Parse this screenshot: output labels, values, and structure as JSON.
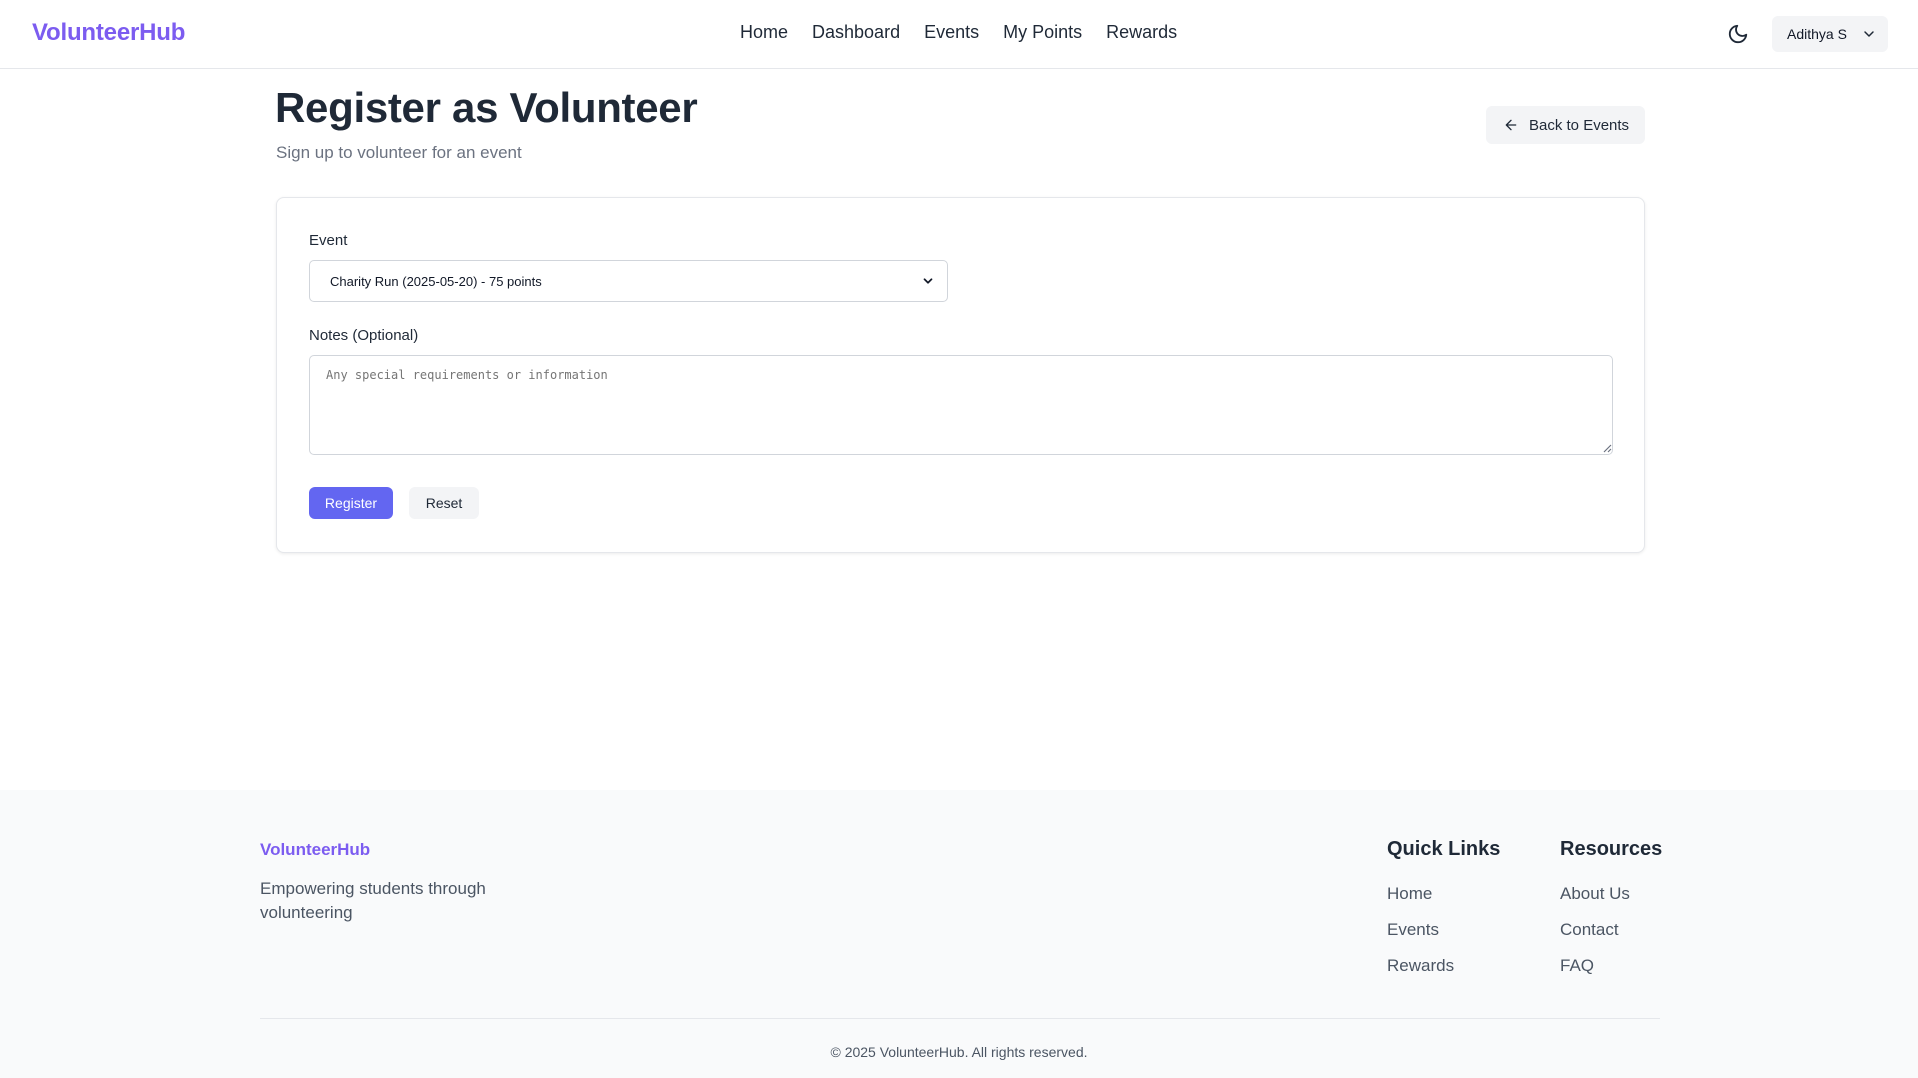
{
  "header": {
    "brand": "VolunteerHub",
    "nav": [
      "Home",
      "Dashboard",
      "Events",
      "My Points",
      "Rewards"
    ],
    "user_name": "Adithya S",
    "theme_icon": "moon-icon"
  },
  "page": {
    "title": "Register as Volunteer",
    "subtitle": "Sign up to volunteer for an event",
    "back_label": "Back to Events"
  },
  "form": {
    "event_label": "Event",
    "event_selected": "Charity Run (2025-05-20) - 75 points",
    "notes_label": "Notes (Optional)",
    "notes_placeholder": "Any special requirements or information",
    "notes_value": "",
    "register_label": "Register",
    "reset_label": "Reset"
  },
  "footer": {
    "brand": "VolunteerHub",
    "tagline": "Empowering students through volunteering",
    "quick_links_title": "Quick Links",
    "quick_links": [
      "Home",
      "Events",
      "Rewards"
    ],
    "resources_title": "Resources",
    "resources": [
      "About Us",
      "Contact",
      "FAQ"
    ],
    "copyright": "© 2025 VolunteerHub. All rights reserved."
  },
  "colors": {
    "brand": "#7c5cf0",
    "primary_button": "#6366f1"
  }
}
